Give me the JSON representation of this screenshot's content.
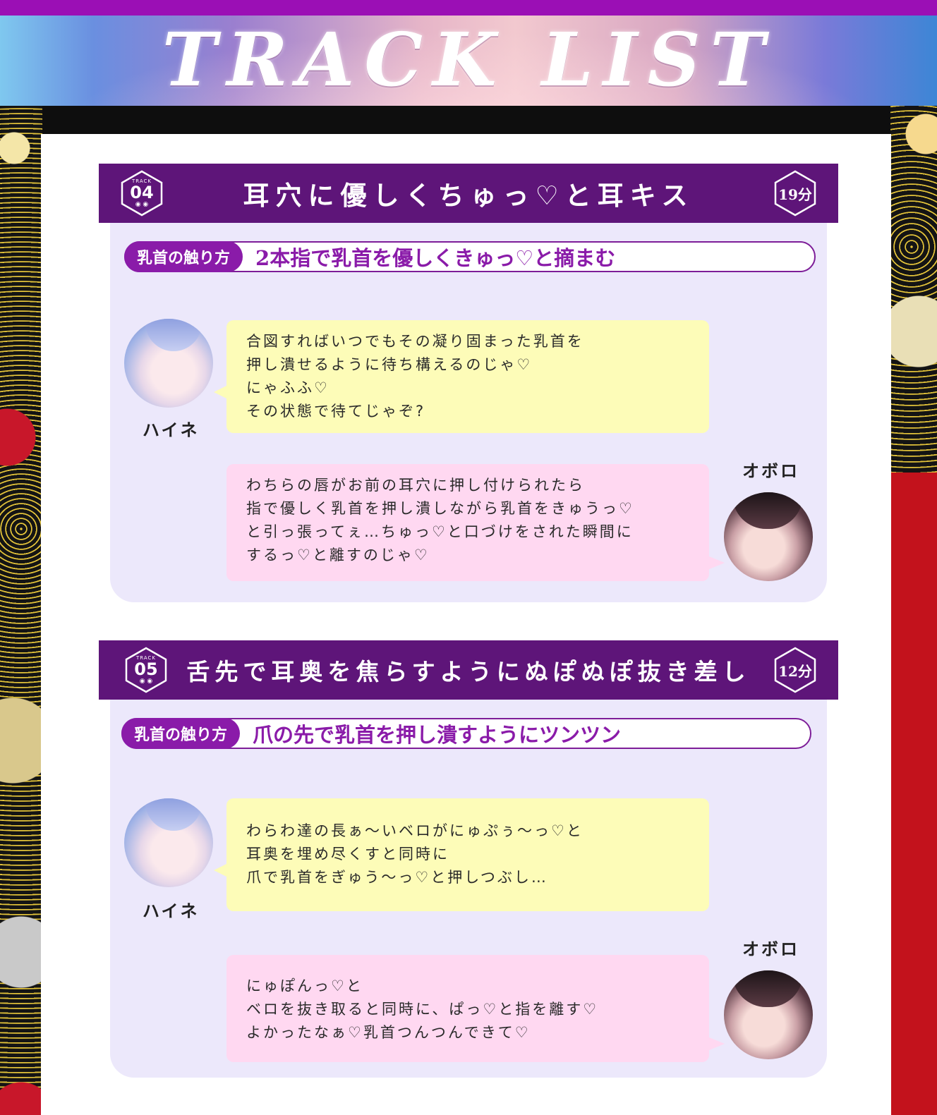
{
  "header": {
    "title": "TRACK LIST"
  },
  "colors": {
    "track_header_bg": "#5e1579",
    "touch_accent": "#8a1ba9",
    "bubble_yellow": "#fdfcb8",
    "bubble_pink": "#ffd8f1",
    "card_bg": "#ece8fb"
  },
  "tracks": [
    {
      "track_label": "TRACK",
      "number": "04",
      "title": "耳穴に優しくちゅっ♡と耳キス",
      "duration": "19分",
      "touch_label": "乳首の触り方",
      "touch_text": "2本指で乳首を優しくきゅっ♡と摘まむ",
      "dialogue": [
        {
          "speaker": "ハイネ",
          "lines": [
            "合図すればいつでもその凝り固まった乳首を",
            "押し潰せるように待ち構えるのじゃ♡",
            "にゃふふ♡",
            "その状態で待てじゃぞ?"
          ]
        },
        {
          "speaker": "オボロ",
          "lines": [
            "わちらの唇がお前の耳穴に押し付けられたら",
            "指で優しく乳首を押し潰しながら乳首をきゅうっ♡",
            "と引っ張ってぇ…ちゅっ♡と口づけをされた瞬間に",
            "するっ♡と離すのじゃ♡"
          ]
        }
      ]
    },
    {
      "track_label": "TRACK",
      "number": "05",
      "title": "舌先で耳奥を焦らすようにぬぽぬぽ抜き差し",
      "duration": "12分",
      "touch_label": "乳首の触り方",
      "touch_text": "爪の先で乳首を押し潰すようにツンツン",
      "dialogue": [
        {
          "speaker": "ハイネ",
          "lines": [
            "わらわ達の長ぁ～いベロがにゅぷぅ～っ♡と",
            "耳奥を埋め尽くすと同時に",
            "爪で乳首をぎゅう～っ♡と押しつぶし…"
          ]
        },
        {
          "speaker": "オボロ",
          "lines": [
            "にゅぽんっ♡と",
            "ベロを抜き取ると同時に、ぱっ♡と指を離す♡",
            "よかったなぁ♡乳首つんつんできて♡"
          ]
        }
      ]
    }
  ]
}
